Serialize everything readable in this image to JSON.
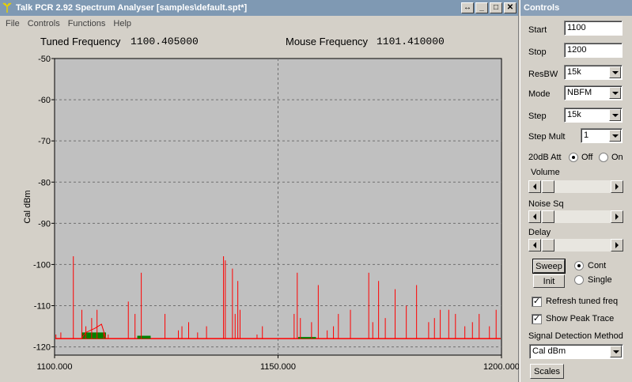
{
  "main_window": {
    "title": "Talk PCR 2.92 Spectrum Analyser [samples\\default.spt*]",
    "menu": [
      "File",
      "Controls",
      "Functions",
      "Help"
    ],
    "tuned_label": "Tuned Frequency",
    "tuned_value": "1100.405000",
    "mouse_label": "Mouse Frequency",
    "mouse_value": "1101.410000"
  },
  "chart_data": {
    "type": "line",
    "ylabel": "Cal dBm",
    "xlim": [
      1100,
      1200
    ],
    "ylim": [
      -122,
      -50
    ],
    "x_ticks": [
      "1100.000",
      "1150.000",
      "1200.000"
    ],
    "y_ticks": [
      "-50",
      "-60",
      "-70",
      "-80",
      "-90",
      "-100",
      "-110",
      "-120"
    ],
    "grid": true,
    "noise_floor": -118,
    "series": [
      {
        "color": "#ff0000",
        "spikes": [
          {
            "x": 1100.3,
            "y": -117
          },
          {
            "x": 1101.4,
            "y": -116.5
          },
          {
            "x": 1104.2,
            "y": -98
          },
          {
            "x": 1106.1,
            "y": -111
          },
          {
            "x": 1107.0,
            "y": -115
          },
          {
            "x": 1108.3,
            "y": -113
          },
          {
            "x": 1109.5,
            "y": -111
          },
          {
            "x": 1111.0,
            "y": -116.5
          },
          {
            "x": 1112.0,
            "y": -117
          },
          {
            "x": 1116.5,
            "y": -109
          },
          {
            "x": 1118.0,
            "y": -112
          },
          {
            "x": 1119.4,
            "y": -102
          },
          {
            "x": 1124.7,
            "y": -112
          },
          {
            "x": 1127.7,
            "y": -116
          },
          {
            "x": 1128.5,
            "y": -115
          },
          {
            "x": 1130.0,
            "y": -114
          },
          {
            "x": 1132.0,
            "y": -116.5
          },
          {
            "x": 1134.0,
            "y": -115
          },
          {
            "x": 1137.8,
            "y": -98
          },
          {
            "x": 1138.2,
            "y": -99
          },
          {
            "x": 1139.8,
            "y": -101
          },
          {
            "x": 1140.4,
            "y": -112
          },
          {
            "x": 1141.0,
            "y": -104
          },
          {
            "x": 1141.5,
            "y": -111
          },
          {
            "x": 1145.3,
            "y": -117
          },
          {
            "x": 1146.5,
            "y": -115
          },
          {
            "x": 1153.6,
            "y": -112
          },
          {
            "x": 1154.3,
            "y": -102
          },
          {
            "x": 1155.0,
            "y": -113
          },
          {
            "x": 1157.5,
            "y": -114
          },
          {
            "x": 1159.0,
            "y": -105
          },
          {
            "x": 1161.0,
            "y": -116
          },
          {
            "x": 1162.4,
            "y": -115
          },
          {
            "x": 1163.5,
            "y": -112
          },
          {
            "x": 1166.2,
            "y": -111
          },
          {
            "x": 1170.3,
            "y": -102
          },
          {
            "x": 1171.2,
            "y": -114
          },
          {
            "x": 1172.5,
            "y": -104
          },
          {
            "x": 1174.0,
            "y": -113
          },
          {
            "x": 1176.2,
            "y": -106
          },
          {
            "x": 1178.7,
            "y": -110
          },
          {
            "x": 1181.0,
            "y": -105
          },
          {
            "x": 1183.7,
            "y": -114
          },
          {
            "x": 1185.0,
            "y": -113
          },
          {
            "x": 1186.3,
            "y": -111
          },
          {
            "x": 1188.2,
            "y": -111
          },
          {
            "x": 1189.7,
            "y": -112
          },
          {
            "x": 1191.8,
            "y": -115
          },
          {
            "x": 1193.5,
            "y": -114
          },
          {
            "x": 1195.0,
            "y": -112
          },
          {
            "x": 1197.3,
            "y": -115
          },
          {
            "x": 1198.8,
            "y": -111
          }
        ]
      },
      {
        "color": "#008000",
        "humps": [
          {
            "x_start": 1106.0,
            "x_end": 1111.5,
            "y": -116.5
          },
          {
            "x_start": 1118.5,
            "x_end": 1121.5,
            "y": -117.3
          },
          {
            "x_start": 1154.5,
            "x_end": 1158.5,
            "y": -117.6
          }
        ]
      }
    ]
  },
  "controls_window": {
    "title": "Controls",
    "start_label": "Start",
    "start_value": "1100",
    "stop_label": "Stop",
    "stop_value": "1200",
    "resbw_label": "ResBW",
    "resbw_value": "15k",
    "mode_label": "Mode",
    "mode_value": "NBFM",
    "step_label": "Step",
    "step_value": "15k",
    "stepmult_label": "Step Mult",
    "stepmult_value": "1",
    "att_label": "20dB Att",
    "att_off": "Off",
    "att_on": "On",
    "att_selected": "Off",
    "volume_label": "Volume",
    "volume_level": 0.05,
    "noise_label": "Noise Sq",
    "noise_level": 0.05,
    "delay_label": "Delay",
    "delay_level": 0.05,
    "sweep_label": "Sweep",
    "init_label": "Init",
    "cont_label": "Cont",
    "single_label": "Single",
    "sweep_mode": "Cont",
    "refresh_label": "Refresh tuned freq",
    "refresh_checked": true,
    "peak_label": "Show Peak Trace",
    "peak_checked": true,
    "detect_label": "Signal Detection Method",
    "detect_value": "Cal dBm",
    "scales_label": "Scales"
  }
}
